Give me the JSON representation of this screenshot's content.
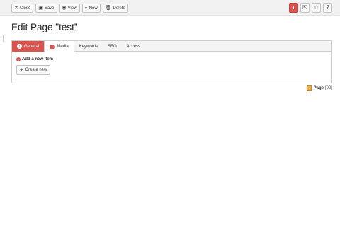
{
  "toolbar": {
    "buttons": [
      {
        "label": "Close",
        "icon": "close-icon"
      },
      {
        "label": "Save",
        "icon": "save-icon"
      },
      {
        "label": "View",
        "icon": "eye-icon"
      },
      {
        "label": "New",
        "icon": "plus-icon"
      },
      {
        "label": "Delete",
        "icon": "trash-icon"
      }
    ],
    "right_icons": [
      "alert-icon",
      "external-link-icon",
      "star-icon",
      "help-icon"
    ],
    "alert_glyph": "!",
    "help_glyph": "?"
  },
  "page": {
    "title": "Edit Page \"test\""
  },
  "tabs": [
    {
      "label": "General",
      "state": "error"
    },
    {
      "label": "Media",
      "state": "active-error"
    },
    {
      "label": "Keywords",
      "state": "normal"
    },
    {
      "label": "SEO",
      "state": "normal"
    },
    {
      "label": "Access",
      "state": "normal"
    }
  ],
  "media": {
    "add_label": "Add a new item",
    "create_button": "Create new"
  },
  "record": {
    "type_label": "Page",
    "id_text": "[92]"
  },
  "colors": {
    "error": "#d9534f",
    "page_icon": "#f0ad4e"
  }
}
